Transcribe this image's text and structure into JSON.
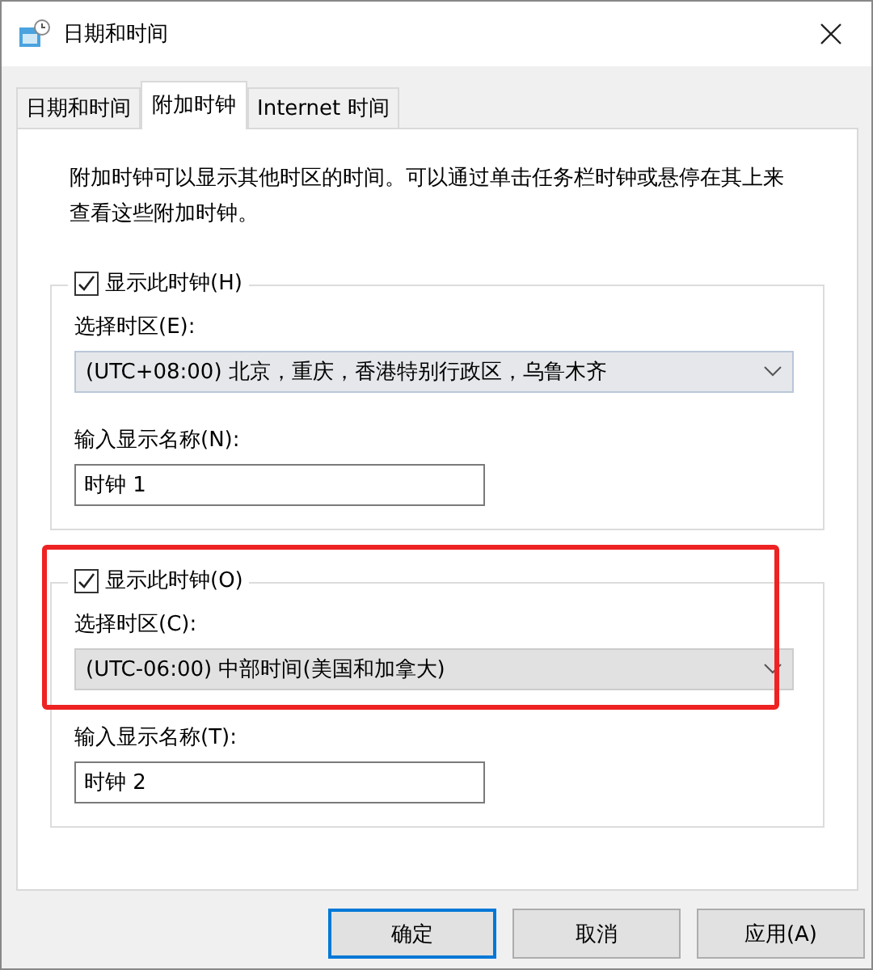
{
  "window": {
    "title": "日期和时间"
  },
  "tabs": [
    {
      "label": "日期和时间",
      "selected": false
    },
    {
      "label": "附加时钟",
      "selected": true
    },
    {
      "label": "Internet 时间",
      "selected": false
    }
  ],
  "description": "附加时钟可以显示其他时区的时间。可以通过单击任务栏时钟或悬停在其上来查看这些附加时钟。",
  "clocks": [
    {
      "show_label": "显示此时钟(H)",
      "checked": true,
      "timezone_label": "选择时区(E):",
      "timezone": "(UTC+08:00) 北京，重庆，香港特别行政区，乌鲁木齐",
      "name_label": "输入显示名称(N):",
      "name": "时钟 1",
      "highlighted": false
    },
    {
      "show_label": "显示此时钟(O)",
      "checked": true,
      "timezone_label": "选择时区(C):",
      "timezone": "(UTC-06:00) 中部时间(美国和加拿大)",
      "name_label": "输入显示名称(T):",
      "name": "时钟 2",
      "highlighted": true
    }
  ],
  "buttons": [
    {
      "label": "确定",
      "default": true
    },
    {
      "label": "取消",
      "default": false
    },
    {
      "label": "应用(A)",
      "default": false
    }
  ]
}
